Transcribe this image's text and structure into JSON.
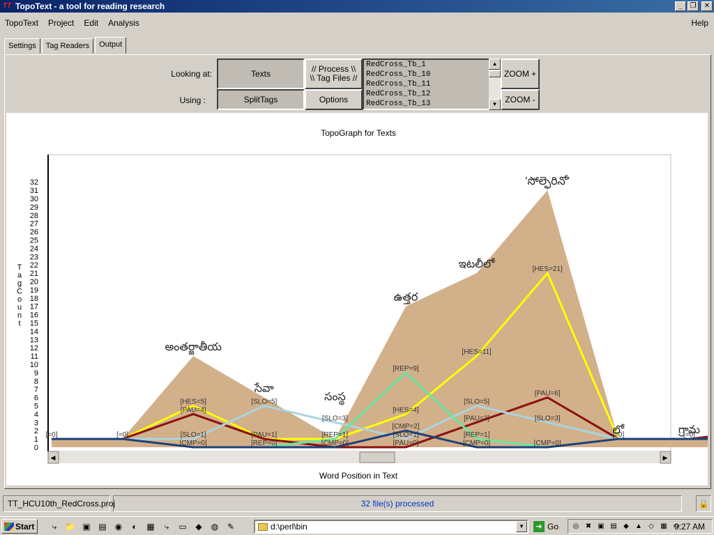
{
  "window": {
    "title": "TopoText - a tool for reading research",
    "app_icon": "TT"
  },
  "menu": {
    "items": [
      "TopoText",
      "Project",
      "Edit",
      "Analysis"
    ],
    "help": "Help"
  },
  "tabs": [
    "Settings",
    "Tag Readers",
    "Output"
  ],
  "controls": {
    "looking_at_label": "Looking at:",
    "looking_at_value": "Texts",
    "using_label": "Using :",
    "using_value": "SplitTags",
    "process_line1": "// Process \\\\",
    "process_line2": "\\\\ Tag Files //",
    "options_label": "Options",
    "zoom_in": "ZOOM +",
    "zoom_out": "ZOOM -",
    "file_list": [
      "RedCross_Tb_1",
      "RedCross_Tb_10",
      "RedCross_Tb_11",
      "RedCross_Tb_12",
      "RedCross_Tb_13"
    ]
  },
  "chart_data": {
    "type": "area",
    "title": "TopoGraph for Texts",
    "xlabel": "Word Position in Text",
    "ylabel": "Tag Count",
    "ylim": [
      0,
      32
    ],
    "yticks": [
      0,
      1,
      2,
      3,
      4,
      5,
      6,
      7,
      8,
      9,
      10,
      11,
      12,
      13,
      14,
      15,
      16,
      17,
      18,
      19,
      20,
      21,
      22,
      23,
      24,
      25,
      26,
      27,
      28,
      29,
      30,
      31,
      32
    ],
    "x": [
      0,
      1,
      2,
      3,
      4,
      5,
      6,
      7,
      8,
      9,
      10
    ],
    "total_area": [
      1,
      1,
      11,
      6,
      1,
      17,
      21,
      31,
      1,
      1,
      1
    ],
    "word_labels": [
      {
        "x": 2,
        "y": 11,
        "text": "అంతర్జాతీయ"
      },
      {
        "x": 3,
        "y": 6,
        "text": "సేవా"
      },
      {
        "x": 4,
        "y": 5,
        "text": "సంస్థ"
      },
      {
        "x": 5,
        "y": 17,
        "text": "ఉత్తర"
      },
      {
        "x": 6,
        "y": 21,
        "text": "ఇటలీలో"
      },
      {
        "x": 7,
        "y": 31,
        "text": "'సోల్ఫెరినో'"
      },
      {
        "x": 8,
        "y": 1,
        "text": "లో"
      },
      {
        "x": 9,
        "y": 1,
        "text": "గ్రామ"
      }
    ],
    "series": [
      {
        "name": "HES",
        "color": "#ffff00",
        "values": [
          1,
          1,
          5,
          1,
          1,
          4,
          11,
          21,
          1,
          1,
          1
        ]
      },
      {
        "name": "PAU",
        "color": "#8b1010",
        "values": [
          1,
          1,
          4,
          1,
          0,
          0,
          3,
          6,
          1,
          1,
          2
        ]
      },
      {
        "name": "SLO",
        "color": "#aad4e0",
        "values": [
          1,
          1,
          1,
          5,
          3,
          1,
          5,
          3,
          1,
          1,
          1
        ]
      },
      {
        "name": "REP",
        "color": "#66e8a0",
        "values": [
          1,
          1,
          0,
          0,
          1,
          9,
          1,
          0,
          1,
          1,
          1
        ]
      },
      {
        "name": "CMP",
        "color": "#1f3f7a",
        "values": [
          1,
          1,
          0,
          0,
          0,
          2,
          0,
          0,
          1,
          1,
          1
        ]
      }
    ],
    "data_labels": [
      {
        "x": 0,
        "y": 1,
        "text": "[=0]"
      },
      {
        "x": 1,
        "y": 1,
        "text": "[=0]"
      },
      {
        "x": 2,
        "y": 5,
        "text": "[HES=5]"
      },
      {
        "x": 2,
        "y": 4,
        "text": "[PAU=4]"
      },
      {
        "x": 2,
        "y": 1,
        "text": "[SLO=1]"
      },
      {
        "x": 2,
        "y": 0,
        "text": "[CMP=0]"
      },
      {
        "x": 3,
        "y": 5,
        "text": "[SLO=5]"
      },
      {
        "x": 3,
        "y": 1,
        "text": "[PAU=1]"
      },
      {
        "x": 3,
        "y": 0,
        "text": "[REP=0]"
      },
      {
        "x": 4,
        "y": 3,
        "text": "[SLO=3]"
      },
      {
        "x": 4,
        "y": 1,
        "text": "[REP=1]"
      },
      {
        "x": 4,
        "y": 0,
        "text": "[CMP=0]"
      },
      {
        "x": 5,
        "y": 9,
        "text": "[REP=9]"
      },
      {
        "x": 5,
        "y": 4,
        "text": "[HES=4]"
      },
      {
        "x": 5,
        "y": 2,
        "text": "[CMP=2]"
      },
      {
        "x": 5,
        "y": 1,
        "text": "[SLO=1]"
      },
      {
        "x": 5,
        "y": 0,
        "text": "[PAU=0]"
      },
      {
        "x": 6,
        "y": 11,
        "text": "[HES=11]"
      },
      {
        "x": 6,
        "y": 5,
        "text": "[SLO=5]"
      },
      {
        "x": 6,
        "y": 3,
        "text": "[PAU=3]"
      },
      {
        "x": 6,
        "y": 1,
        "text": "[REP=1]"
      },
      {
        "x": 6,
        "y": 0,
        "text": "[CMP=0]"
      },
      {
        "x": 7,
        "y": 21,
        "text": "[HES=21]"
      },
      {
        "x": 7,
        "y": 6,
        "text": "[PAU=6]"
      },
      {
        "x": 7,
        "y": 3,
        "text": "[SLO=3]"
      },
      {
        "x": 7,
        "y": 0,
        "text": "[CMP=0]"
      },
      {
        "x": 8,
        "y": 1,
        "text": "[=0]"
      },
      {
        "x": 9,
        "y": 1,
        "text": "[=0]"
      }
    ]
  },
  "status": {
    "project": "TT_HCU10th_RedCross.proj",
    "message": "32 file(s) processed",
    "message_color": "#0033cc"
  },
  "taskbar": {
    "start_label": "Start",
    "address": "d:\\perl\\bin",
    "go_label": "Go",
    "clock": "9:27 AM"
  }
}
